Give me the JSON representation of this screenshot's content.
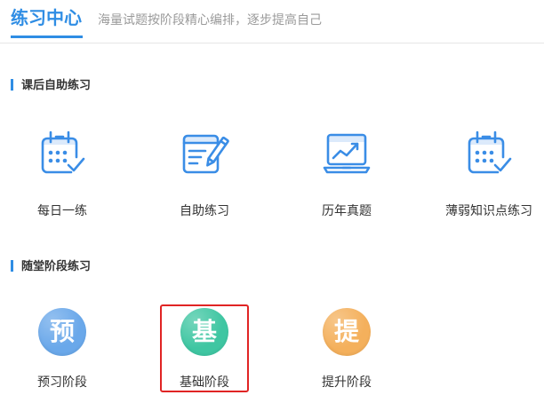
{
  "header": {
    "title": "练习中心",
    "subtitle": "海量试题按阶段精心编排，逐步提高自己"
  },
  "colors": {
    "accent": "#2f8de4",
    "icon_stroke": "#3a8de6",
    "highlight_border": "#e02424"
  },
  "sections": [
    {
      "title": "课后自助练习",
      "items": [
        {
          "label": "每日一练",
          "icon": "calendar-check-icon"
        },
        {
          "label": "自助练习",
          "icon": "form-pencil-icon"
        },
        {
          "label": "历年真题",
          "icon": "laptop-chart-icon"
        },
        {
          "label": "薄弱知识点练习",
          "icon": "calendar-check-icon"
        }
      ]
    },
    {
      "title": "随堂阶段练习",
      "items": [
        {
          "label": "预习阶段",
          "glyph": "预",
          "color": "#6aa8ea"
        },
        {
          "label": "基础阶段",
          "glyph": "基",
          "color": "#3fc6a2"
        },
        {
          "label": "提升阶段",
          "glyph": "提",
          "color": "#f4b05c"
        }
      ]
    }
  ]
}
